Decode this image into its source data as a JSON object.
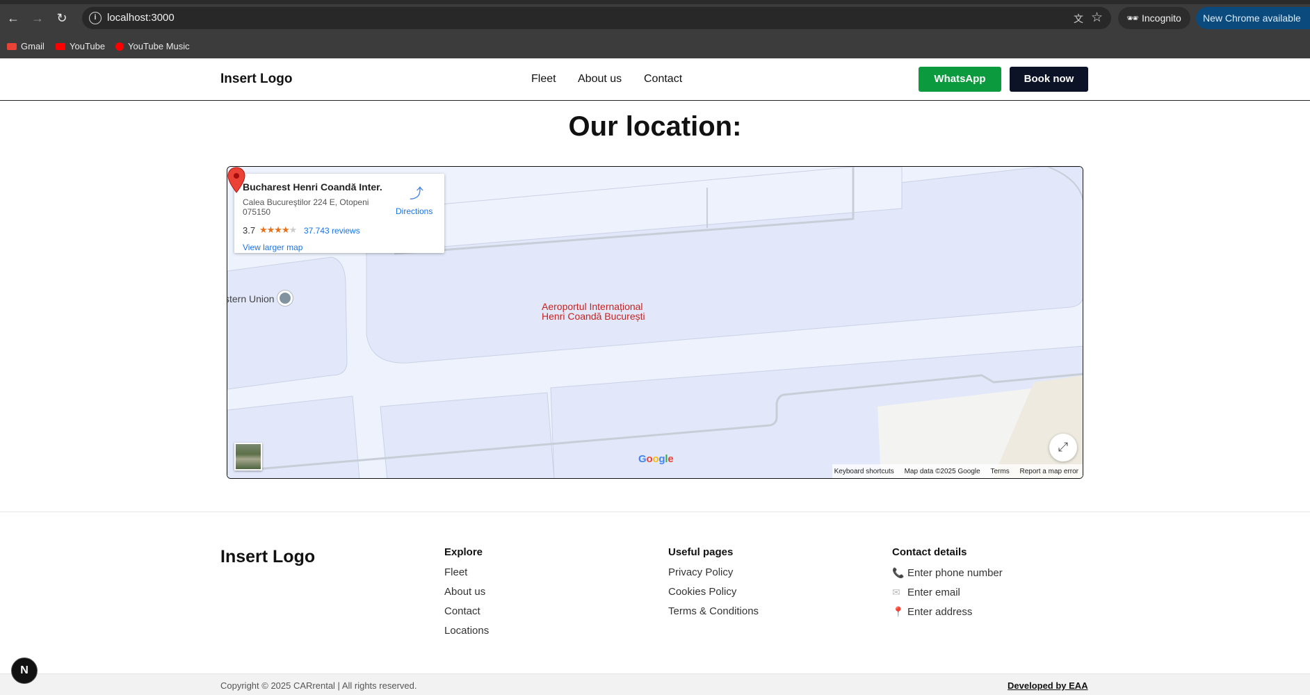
{
  "browser": {
    "url": "localhost:3000",
    "incognito_label": "Incognito",
    "update_label": "New Chrome available",
    "bookmarks": [
      {
        "label": "Gmail",
        "icon": "gmail-icon",
        "color": "#ea4335"
      },
      {
        "label": "YouTube",
        "icon": "youtube-icon",
        "color": "#ff0000"
      },
      {
        "label": "YouTube Music",
        "icon": "youtube-music-icon",
        "color": "#ff0000"
      }
    ]
  },
  "header": {
    "logo": "Insert Logo",
    "nav": [
      "Fleet",
      "About us",
      "Contact"
    ],
    "whatsapp_label": "WhatsApp",
    "book_label": "Book now",
    "whatsapp_color": "#0b9a3e",
    "book_color": "#0d1326"
  },
  "location": {
    "title": "Our location:"
  },
  "map": {
    "place_name": "Bucharest Henri Coandă Inter...",
    "address": "Calea Bucureştilor 224 E, Otopeni 075150",
    "rating": "3.7",
    "stars": 3.5,
    "reviews": "37.743 reviews",
    "directions_label": "Directions",
    "larger_map_label": "View larger map",
    "poi_label": "stern Union",
    "airport_label_line1": "Aeroportul Internațional",
    "airport_label_line2": "Henri Coandă București",
    "google_logo": "Google",
    "footer_links": [
      "Keyboard shortcuts",
      "Map data ©2025 Google",
      "Terms",
      "Report a map error"
    ]
  },
  "footer": {
    "logo": "Insert Logo",
    "explore": {
      "title": "Explore",
      "links": [
        "Fleet",
        "About us",
        "Contact",
        "Locations"
      ]
    },
    "useful": {
      "title": "Useful pages",
      "links": [
        "Privacy Policy",
        "Cookies Policy",
        "Terms & Conditions"
      ]
    },
    "contact": {
      "title": "Contact details",
      "items": [
        {
          "icon": "phone-icon",
          "text": "Enter phone number"
        },
        {
          "icon": "email-icon",
          "text": "Enter email"
        },
        {
          "icon": "location-pin-icon",
          "text": "Enter address"
        }
      ]
    },
    "copyright": "Copyright © 2025 CARrental | All rights reserved.",
    "developed_by": "Developed by EAA"
  },
  "dev_badge": "N"
}
